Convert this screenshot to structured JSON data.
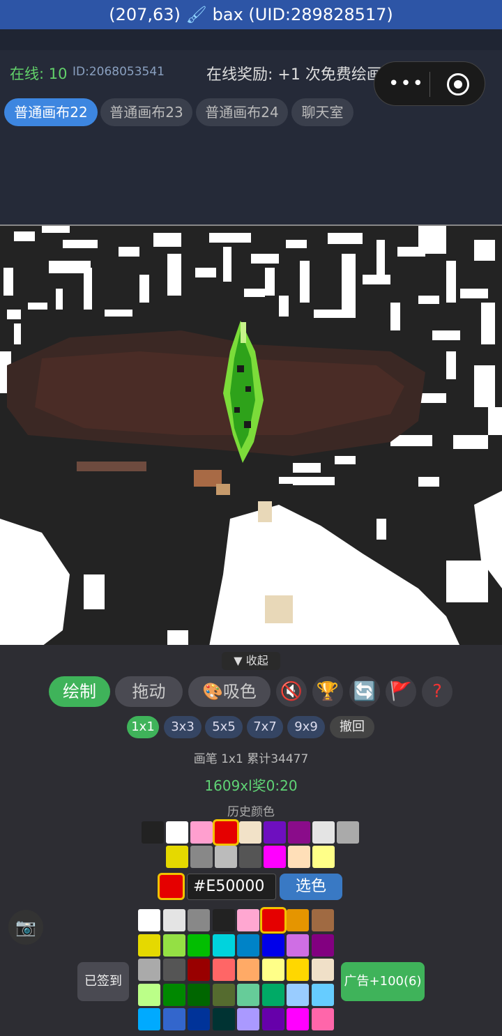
{
  "topbar": {
    "coords": "(207,63)",
    "user": "bax (UID:289828517)"
  },
  "header": {
    "online": "在线: 10",
    "id": "ID:2068053541",
    "reward": "在线奖励: +1 次免费绘画!"
  },
  "tabs": [
    "普通画布22",
    "普通画布23",
    "普通画布24",
    "聊天室"
  ],
  "panel": {
    "collapse": "▼ 收起",
    "modes": [
      "绘制",
      "拖动",
      "🎨吸色"
    ],
    "icons": [
      "mute-icon",
      "trophy-icon",
      "refresh-icon",
      "flag-icon",
      "help-icon"
    ],
    "sizes": [
      "1x1",
      "3x3",
      "5x5",
      "7x7",
      "9x9"
    ],
    "undo": "撤回",
    "brush_info": "画笔 1x1 累计34477",
    "award": "1609xl奖0:20",
    "history_label": "历史颜色",
    "history_colors": [
      "#222222",
      "#ffffff",
      "#ff9fcf",
      "#e50000",
      "#f2e2c8",
      "#6e0fbf",
      "#8a0c8a",
      "#e4e4e4",
      "#aaaaaa",
      "#e5d900",
      "#888888",
      "#bbbbbb",
      "#555555",
      "#ff00ff",
      "#ffdfb8",
      "#ffff88"
    ],
    "current_color": "#E50000",
    "pick_label": "选色",
    "palette": [
      "#ffffff",
      "#e4e4e4",
      "#888888",
      "#222222",
      "#ffa7d1",
      "#e50000",
      "#e59500",
      "#a06a42",
      "#e5d900",
      "#94e044",
      "#02be01",
      "#00d3dd",
      "#0083c7",
      "#0000ea",
      "#cf6ee4",
      "#820080",
      "#aaaaaa",
      "#555555",
      "#990000",
      "#ff6666",
      "#ffaa66",
      "#ffff88",
      "#ffd700",
      "#f0e0c8",
      "#bbff88",
      "#008800",
      "#006600",
      "#556b2f",
      "#66cc99",
      "#00aa66",
      "#99ccff",
      "#66ccff",
      "#00aaff",
      "#3366cc",
      "#003399",
      "#003333",
      "#aa99ff",
      "#6600aa",
      "#ff00ff",
      "#ff66aa"
    ],
    "signed": "已签到",
    "ad": "广告+100(6)"
  }
}
